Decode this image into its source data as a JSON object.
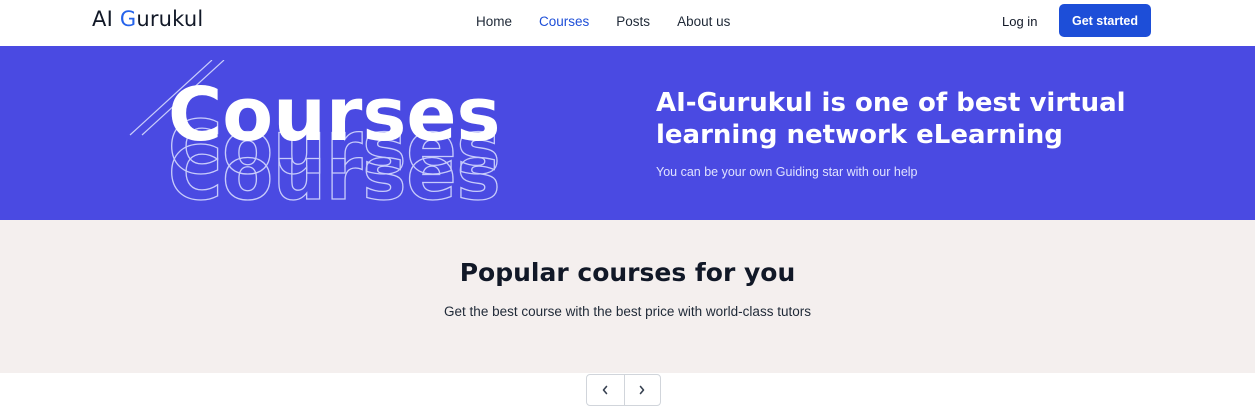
{
  "navbar": {
    "brand_prefix": "AI ",
    "brand_accent": "G",
    "brand_suffix": "urukul",
    "links": [
      "Home",
      "Courses",
      "Posts",
      "About us"
    ],
    "active_link": "Courses",
    "login_label": "Log in",
    "cta_label": "Get started"
  },
  "hero": {
    "art_word": "Courses",
    "heading": "AI-Gurukul is one of best virtual learning network eLearning",
    "subtitle": "You can be your own Guiding star with our help"
  },
  "section": {
    "title": "Popular courses for you",
    "subtitle": "Get the best course with the best price with world-class tutors"
  },
  "pagination": {
    "prev_icon": "chevron-left-icon",
    "next_icon": "chevron-right-icon"
  },
  "colors": {
    "brand_accent": "#2563eb",
    "hero_bg": "#4a4ae2",
    "section_bg": "#f4efee",
    "cta_bg": "#1d4ed8"
  }
}
